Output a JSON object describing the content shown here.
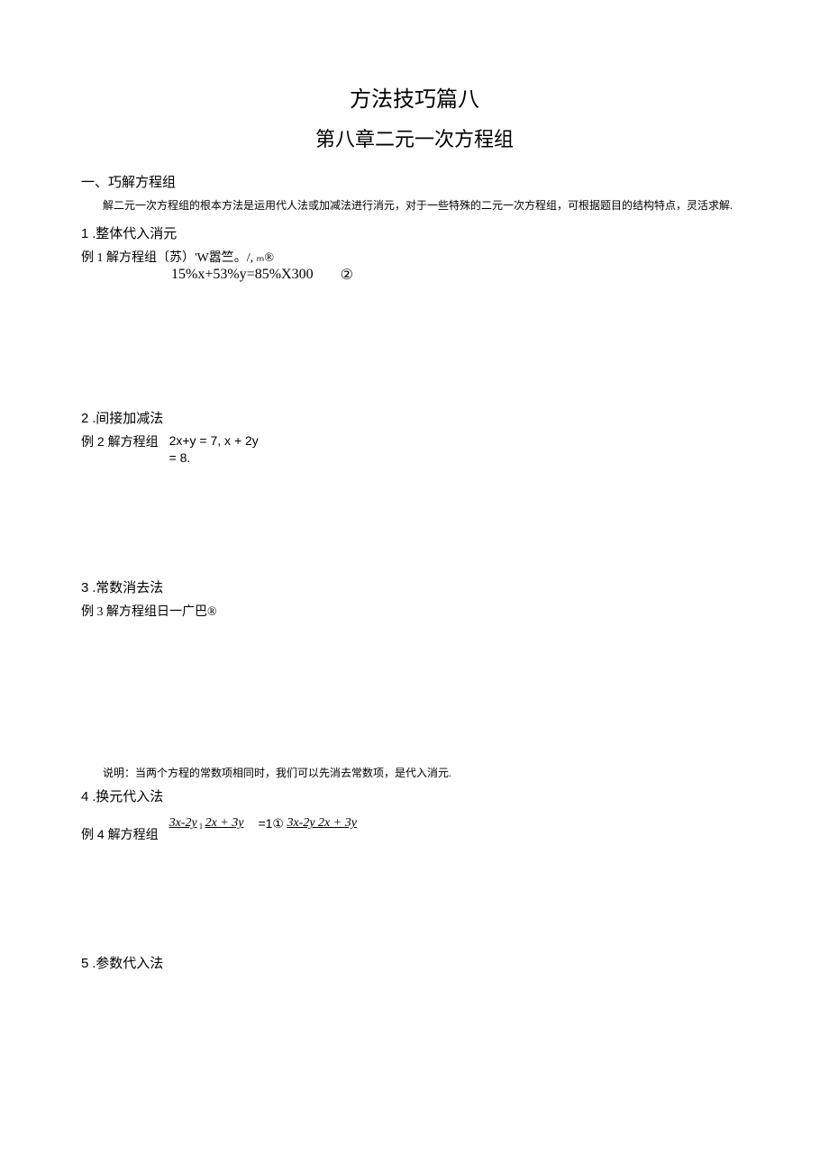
{
  "title": "方法技巧篇八",
  "subtitle": "第八章二元一次方程组",
  "section1": {
    "heading": "一、巧解方程组",
    "intro": "解二元一次方程组的根本方法是运用代人法或加减法进行消元，对于一些特殊的二元一次方程组，可根据题目的结构特点，灵活求解."
  },
  "item1": {
    "num": "1",
    "label": ".整体代入消元",
    "example_label": "例 1 解方程组〔苏）'W嚣竺。/, ₘ®",
    "eq2": "15%x+53%y=85%X300",
    "mark2": "②"
  },
  "item2": {
    "num": "2",
    "label": ".间接加减法",
    "example_label": "例 2 解方程组",
    "eq_block": "2x+y = 7, x + 2y = 8."
  },
  "item3": {
    "num": "3",
    "label": ".常数消去法",
    "example_label": "例 3 解方程组日一广巴®",
    "note": "说明：当两个方程的常数项相同时，我们可以先消去常数项，是代入消元."
  },
  "item4": {
    "num": "4",
    "label": ".换元代入法",
    "example_label": "例 4 解方程组",
    "frac1a": "3x-2y",
    "sep1": "₁",
    "frac1b": "2x + 3y",
    "rhs1": "=1①",
    "frac2": "3x-2y 2x + 3y"
  },
  "item5": {
    "num": "5",
    "label": ".参数代入法"
  }
}
